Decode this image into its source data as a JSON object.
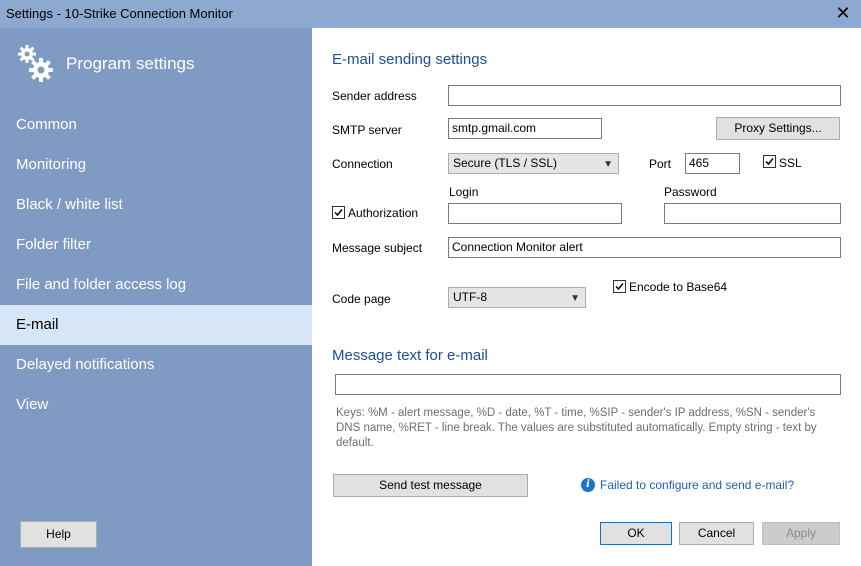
{
  "window": {
    "title": "Settings - 10-Strike Connection Monitor",
    "close_glyph": "✕"
  },
  "sidebar": {
    "title": "Program settings",
    "items": [
      {
        "label": "Common"
      },
      {
        "label": "Monitoring"
      },
      {
        "label": "Black / white list"
      },
      {
        "label": "Folder filter"
      },
      {
        "label": "File and folder access log"
      },
      {
        "label": "E-mail"
      },
      {
        "label": "Delayed notifications"
      },
      {
        "label": "View"
      }
    ],
    "active_index": 5,
    "help_label": "Help"
  },
  "email": {
    "section_title": "E-mail sending settings",
    "sender_label": "Sender address",
    "sender_value": "",
    "smtp_label": "SMTP server",
    "smtp_value": "smtp.gmail.com",
    "proxy_button": "Proxy Settings...",
    "connection_label": "Connection",
    "connection_value": "Secure (TLS / SSL)",
    "port_label": "Port",
    "port_value": "465",
    "ssl_label": "SSL",
    "ssl_checked": true,
    "login_label": "Login",
    "password_label": "Password",
    "auth_label": "Authorization",
    "auth_checked": true,
    "login_value": "",
    "password_value": "",
    "subject_label": "Message subject",
    "subject_value": "Connection Monitor alert",
    "codepage_label": "Code page",
    "codepage_value": "UTF-8",
    "base64_label": "Encode to Base64",
    "base64_checked": true,
    "message_title": "Message text for e-mail",
    "message_value": "",
    "hint": "Keys: %M - alert message, %D - date, %T - time, %SIP - sender's IP address, %SN - sender's DNS name, %RET - line break. The values are substituted automatically. Empty string - text by default.",
    "send_test_button": "Send test message",
    "help_link": "Failed to configure and send e-mail?"
  },
  "footer": {
    "ok": "OK",
    "cancel": "Cancel",
    "apply": "Apply"
  },
  "colors": {
    "sidebar_bg": "#7f9bc3",
    "active_item": "#d6e6f7",
    "heading": "#1f4e9c",
    "link": "#1f5fb4"
  }
}
